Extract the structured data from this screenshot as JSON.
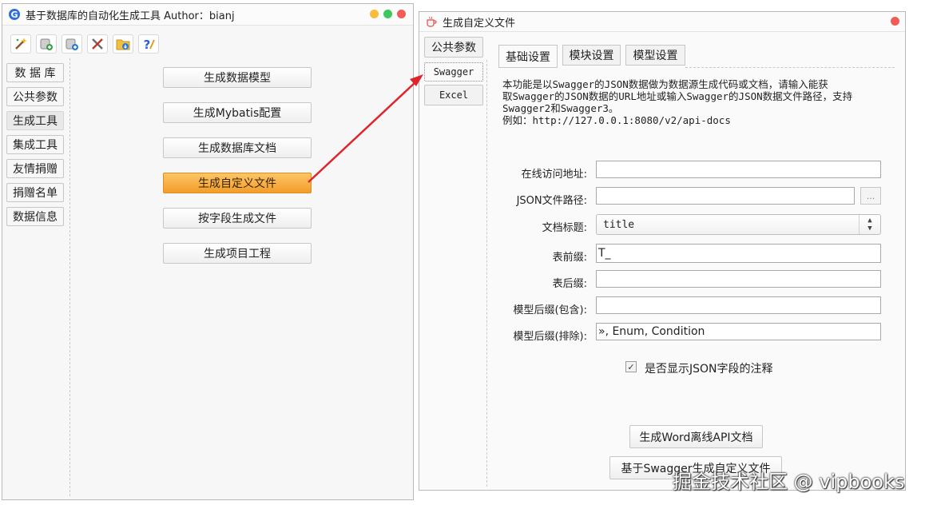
{
  "window1": {
    "title": "基于数据库的自动化生成工具  Author：bianj",
    "toolbar": {
      "icons": [
        "wand-icon",
        "add-database-icon",
        "add-database-plus-icon",
        "tools-icon",
        "folder-download-icon",
        "help-icon"
      ]
    },
    "nav": [
      "数 据 库",
      "公共参数",
      "生成工具",
      "集成工具",
      "友情捐赠",
      "捐赠名单",
      "数据信息"
    ],
    "active_nav": "生成工具",
    "actions": [
      "生成数据模型",
      "生成Mybatis配置",
      "生成数据库文档",
      "生成自定义文件",
      "按字段生成文件",
      "生成项目工程"
    ],
    "highlighted_action": "生成自定义文件"
  },
  "window2": {
    "title": "生成自定义文件",
    "side_tabs": [
      "公共参数",
      "Swagger",
      "Excel"
    ],
    "active_side_tab": "Swagger",
    "tabs": [
      "基础设置",
      "模块设置",
      "模型设置"
    ],
    "active_tab": "基础设置",
    "description": "    本功能是以Swagger的JSON数据做为数据源生成代码或文档，请输入能获\n取Swagger的JSON数据的URL地址或输入Swagger的JSON数据文件路径，支持\nSwagger2和Swagger3。\n例如：http://127.0.0.1:8080/v2/api-docs",
    "form": {
      "online_url_label": "在线访问地址:",
      "online_url_value": "",
      "json_path_label": "JSON文件路径:",
      "json_path_value": "",
      "browse_label": "...",
      "doc_title_label": "文档标题:",
      "doc_title_value": "title",
      "table_prefix_label": "表前缀:",
      "table_prefix_value": "T_",
      "table_suffix_label": "表后缀:",
      "table_suffix_value": "",
      "model_suffix_include_label": "模型后缀(包含):",
      "model_suffix_include_value": "",
      "model_suffix_exclude_label": "模型后缀(排除):",
      "model_suffix_exclude_value": "», Enum, Condition"
    },
    "show_json_comments_label": "是否显示JSON字段的注释",
    "show_json_comments_checked": true,
    "buttons": {
      "word_doc": "生成Word离线API文档",
      "custom_file": "基于Swagger生成自定义文件"
    }
  },
  "watermark": "掘金技术社区 @ vipbooks",
  "colors": {
    "accent_orange": "#f5a33a",
    "arrow_red": "#e0242b",
    "close_red": "#f25b58",
    "min_yellow": "#f8bd3c",
    "max_green": "#3cc85a"
  }
}
